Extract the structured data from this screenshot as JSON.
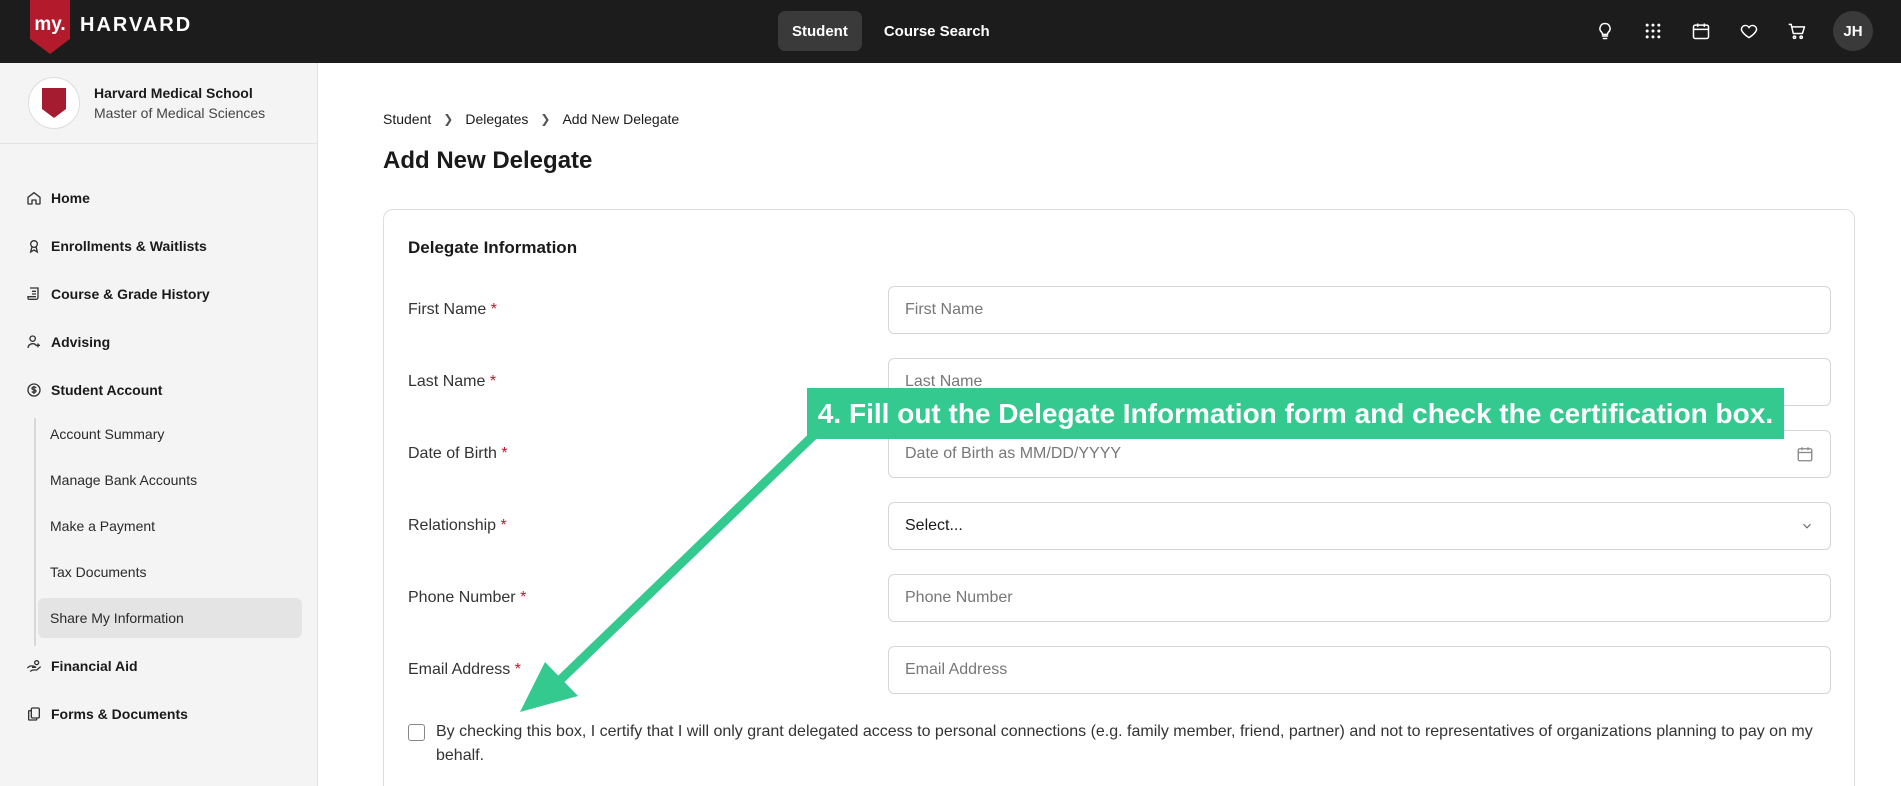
{
  "header": {
    "logo_badge": "my.",
    "logo_word": "HARVARD",
    "nav": [
      {
        "label": "Student",
        "active": true
      },
      {
        "label": "Course Search",
        "active": false
      }
    ],
    "icons": [
      "lightbulb-icon",
      "apps-grid-icon",
      "calendar-icon",
      "heart-icon",
      "cart-icon"
    ],
    "avatar_initials": "JH"
  },
  "sidebar": {
    "school_name": "Harvard Medical School",
    "program": "Master of Medical Sciences",
    "items": [
      {
        "label": "Home",
        "icon": "home-icon"
      },
      {
        "label": "Enrollments & Waitlists",
        "icon": "ribbon-icon"
      },
      {
        "label": "Course & Grade History",
        "icon": "scroll-icon"
      },
      {
        "label": "Advising",
        "icon": "person-icon"
      },
      {
        "label": "Student Account",
        "icon": "dollar-icon"
      },
      {
        "label": "Financial Aid",
        "icon": "hand-coin-icon"
      },
      {
        "label": "Forms & Documents",
        "icon": "documents-icon"
      }
    ],
    "sub_items": [
      {
        "label": "Account Summary"
      },
      {
        "label": "Manage Bank Accounts"
      },
      {
        "label": "Make a Payment"
      },
      {
        "label": "Tax Documents"
      },
      {
        "label": "Share My Information",
        "selected": true
      }
    ]
  },
  "main": {
    "breadcrumb": [
      "Student",
      "Delegates",
      "Add New Delegate"
    ],
    "title": "Add New Delegate",
    "card_title": "Delegate Information",
    "required_mark": "*",
    "fields": [
      {
        "label": "First Name",
        "placeholder": "First Name"
      },
      {
        "label": "Last Name",
        "placeholder": "Last Name"
      },
      {
        "label": "Date of Birth",
        "placeholder": "Date of Birth as MM/DD/YYYY"
      },
      {
        "label": "Relationship",
        "value": "Select..."
      },
      {
        "label": "Phone Number",
        "placeholder": "Phone Number"
      },
      {
        "label": "Email Address",
        "placeholder": "Email Address"
      }
    ],
    "certification_text": "By checking this box, I certify that I will only grant delegated access to personal connections (e.g. family member, friend, partner) and not to representatives of organizations planning to pay on my behalf.",
    "certification_checked": false
  },
  "overlay": {
    "callout": "4. Fill out the Delegate Information form and check the certification box.",
    "accent_color": "#34c98e"
  }
}
